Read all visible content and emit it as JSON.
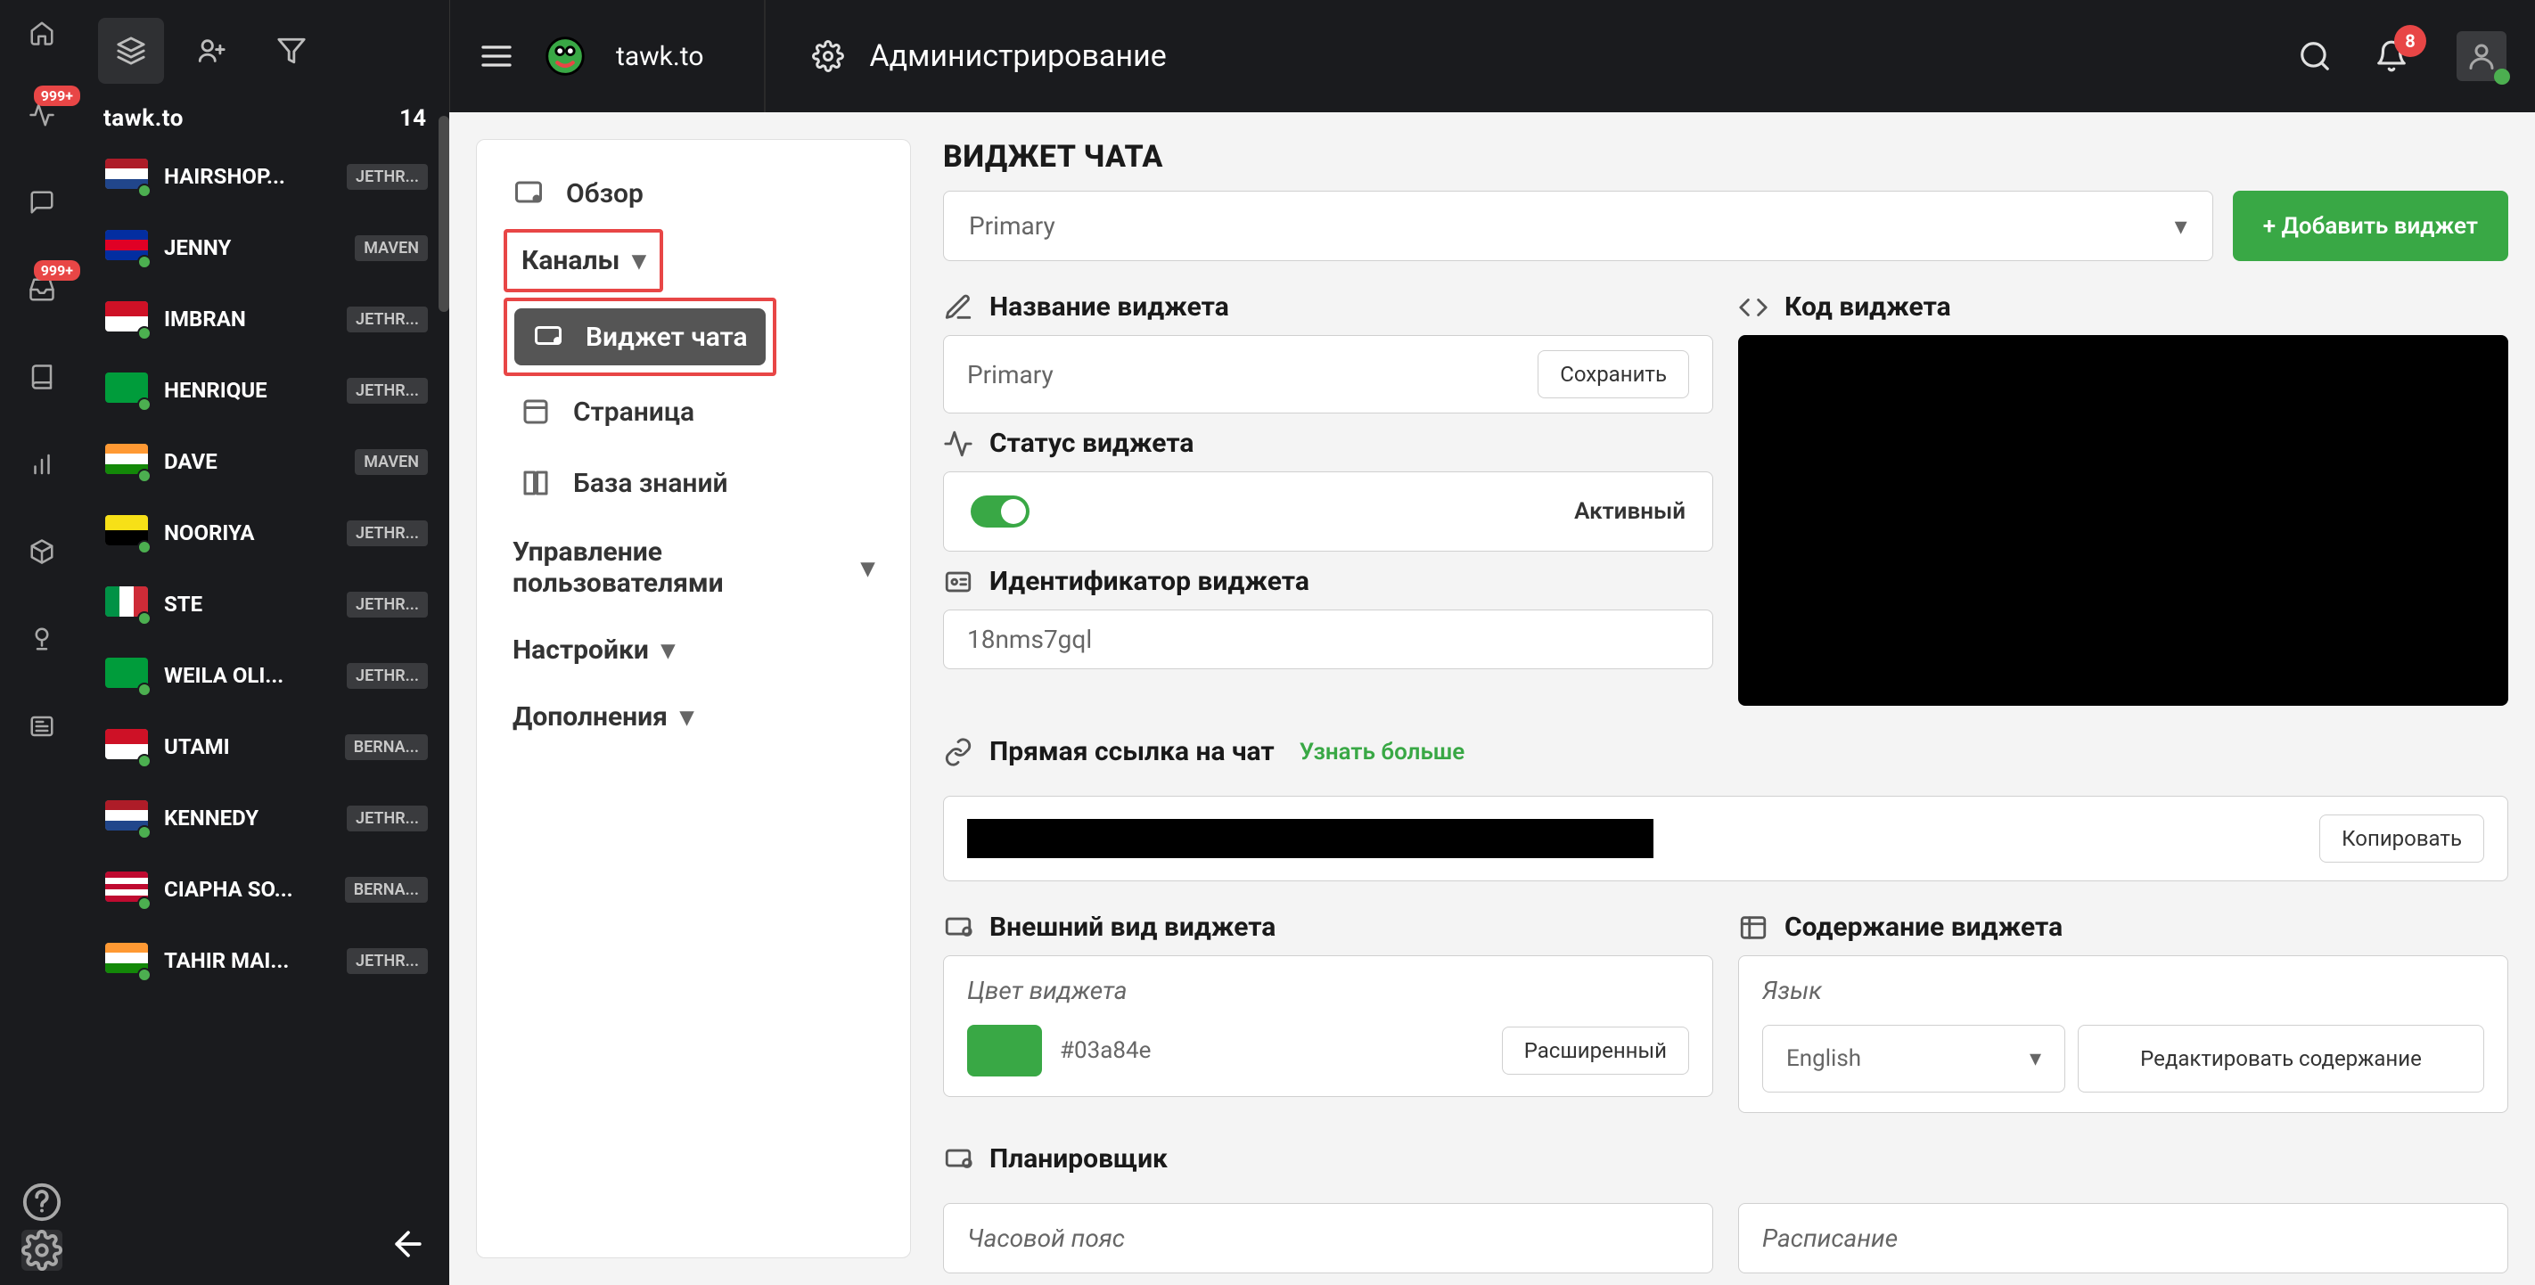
{
  "nav_strip": {
    "home": "home",
    "badge_999": "999+",
    "inbox_badge": "999+",
    "bell_badge": "8"
  },
  "chat_panel": {
    "title": "tawk.to",
    "count": "14",
    "chats": [
      {
        "name": "HAIRSHOP...",
        "tag": "JETHR...",
        "flag": "nl"
      },
      {
        "name": "JENNY",
        "tag": "MAVEN",
        "flag": "kh"
      },
      {
        "name": "IMBRAN",
        "tag": "JETHR...",
        "flag": "id"
      },
      {
        "name": "HENRIQUE",
        "tag": "JETHR...",
        "flag": "br"
      },
      {
        "name": "DAVE",
        "tag": "MAVEN",
        "flag": "in"
      },
      {
        "name": "NOORIYA",
        "tag": "JETHR...",
        "flag": "bn"
      },
      {
        "name": "STE",
        "tag": "JETHR...",
        "flag": "it"
      },
      {
        "name": "WEILA OLI...",
        "tag": "JETHR...",
        "flag": "br"
      },
      {
        "name": "UTAMI",
        "tag": "BERNA...",
        "flag": "id"
      },
      {
        "name": "KENNEDY",
        "tag": "JETHR...",
        "flag": "nl"
      },
      {
        "name": "CIAPHA SO...",
        "tag": "BERNA...",
        "flag": "lr"
      },
      {
        "name": "TAHIR MAI...",
        "tag": "JETHR...",
        "flag": "in"
      }
    ]
  },
  "topbar": {
    "brand": "tawk.to",
    "breadcrumb": "Администрирование",
    "bell_badge": "8"
  },
  "menu": {
    "overview": "Обзор",
    "channels": "Каналы",
    "chat_widget": "Виджет чата",
    "page": "Страница",
    "kb": "База знаний",
    "users": "Управление пользователями",
    "settings": "Настройки",
    "addons": "Дополнения"
  },
  "content": {
    "page_title": "ВИДЖЕТ ЧАТА",
    "primary_select": "Primary",
    "add_widget": "+ Добавить виджет",
    "widget_name_label": "Название виджета",
    "widget_name_value": "Primary",
    "save": "Сохранить",
    "widget_code_label": "Код виджета",
    "widget_status_label": "Статус виджета",
    "status_active": "Активный",
    "widget_id_label": "Идентификатор виджета",
    "widget_id_value": "18nms7gql",
    "direct_link_label": "Прямая ссылка на чат",
    "learn_more": "Узнать больше",
    "copy": "Копировать",
    "appearance_label": "Внешний вид виджета",
    "widget_content_label": "Содержание виджета",
    "color_label": "Цвет виджета",
    "color_hex": "#03a84e",
    "advanced": "Расширенный",
    "language_label": "Язык",
    "language_value": "English",
    "edit_content": "Редактировать содержание",
    "scheduler_label": "Планировщик",
    "timezone": "Часовой пояс",
    "schedule": "Расписание"
  },
  "flags": {
    "nl": [
      [
        "#ae1c28",
        "#fff",
        "#21468b"
      ]
    ],
    "kh": [
      [
        "#032ea1",
        "#e00025",
        "#032ea1"
      ]
    ],
    "id": [
      [
        "#ce1126",
        "#fff"
      ]
    ],
    "br": [
      [
        "#009c3b"
      ]
    ],
    "in": [
      [
        "#ff9933",
        "#fff",
        "#138808"
      ]
    ],
    "bn": [
      [
        "#f7e017",
        "#000"
      ]
    ],
    "it": [
      [
        "#009246",
        "#fff",
        "#ce2b37"
      ]
    ],
    "lr": [
      [
        "#bf0a30",
        "#fff",
        "#bf0a30",
        "#fff",
        "#bf0a30"
      ]
    ]
  }
}
